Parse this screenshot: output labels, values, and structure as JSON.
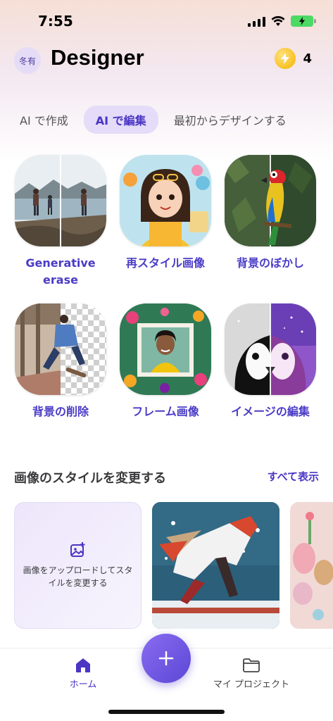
{
  "status_bar": {
    "time": "7:55"
  },
  "header": {
    "avatar_text": "冬有",
    "title": "Designer",
    "credits": "4"
  },
  "tabs": [
    {
      "label": "AI で作成",
      "active": false
    },
    {
      "label": "AI で編集",
      "active": true
    },
    {
      "label": "最初からデザインする",
      "active": false
    }
  ],
  "features": [
    {
      "label": "Generative erase",
      "icon": "generative-erase"
    },
    {
      "label": "再スタイル画像",
      "icon": "restyle-image"
    },
    {
      "label": "背景のぼかし",
      "icon": "background-blur"
    },
    {
      "label": "背景の削除",
      "icon": "background-remove"
    },
    {
      "label": "フレーム画像",
      "icon": "frame-image"
    },
    {
      "label": "イメージの編集",
      "icon": "image-edit"
    }
  ],
  "section": {
    "title": "画像のスタイルを変更する",
    "see_all": "すべて表示",
    "upload_text": "画像をアップロードしてスタイルを変更する"
  },
  "bottom_nav": {
    "home_label": "ホーム",
    "projects_label": "マイ プロジェクト"
  },
  "colors": {
    "accent": "#4a35c4",
    "fab": "#6b52e0"
  }
}
